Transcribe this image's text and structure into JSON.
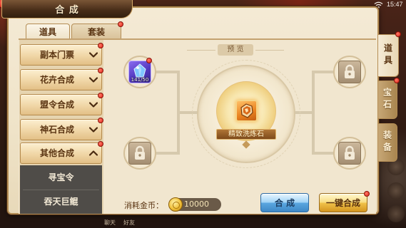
{
  "status_bar": {
    "time": "15:47",
    "wifi_icon": "wifi-icon"
  },
  "window": {
    "title": "合 成"
  },
  "top_tabs": [
    {
      "label": "道具",
      "selected": true,
      "badge": false
    },
    {
      "label": "套装",
      "selected": false,
      "badge": true
    }
  ],
  "sidebar": {
    "categories": [
      {
        "label": "副本门票",
        "expanded": false,
        "badge": true
      },
      {
        "label": "花卉合成",
        "expanded": false,
        "badge": true
      },
      {
        "label": "盟令合成",
        "expanded": false,
        "badge": true
      },
      {
        "label": "神石合成",
        "expanded": false,
        "badge": true
      },
      {
        "label": "其他合成",
        "expanded": true,
        "badge": true
      }
    ],
    "sub_items": [
      {
        "label": "寻宝令"
      },
      {
        "label": "吞天巨鲲"
      }
    ]
  },
  "preview": {
    "label": "预 览",
    "result_item": {
      "name": "精致洗炼石",
      "icon": "orange-stone-icon"
    },
    "materials": [
      {
        "icon": "purple-stone-icon",
        "count": "141/50",
        "locked": false,
        "badge": true
      },
      {
        "icon": "lock-icon",
        "locked": true,
        "badge": false
      },
      {
        "icon": "lock-icon",
        "locked": true,
        "badge": false
      },
      {
        "icon": "lock-icon",
        "locked": true,
        "badge": false
      }
    ]
  },
  "cost": {
    "label": "消耗金币：",
    "currency_icon": "gold-coin-icon",
    "amount": "10000"
  },
  "buttons": {
    "synthesize": {
      "label": "合 成",
      "badge": false
    },
    "synthesize_all": {
      "label": "一键合成",
      "badge": true
    }
  },
  "side_tabs": [
    {
      "label": "道具",
      "selected": true,
      "badge": true
    },
    {
      "label": "宝石",
      "selected": false,
      "badge": true
    },
    {
      "label": "装备",
      "selected": false,
      "badge": false
    }
  ],
  "background_labels": {
    "chat": "聊天",
    "friends": "好友"
  },
  "colors": {
    "panel_bg": "#efe3c8",
    "panel_border": "#b48d55",
    "text_brown": "#5a3412",
    "badge_red": "#e0261b",
    "synth_button": "#5aa6e0",
    "synth_all_button": "#f0c24a",
    "sub_item_bg": "#4f4c48"
  }
}
